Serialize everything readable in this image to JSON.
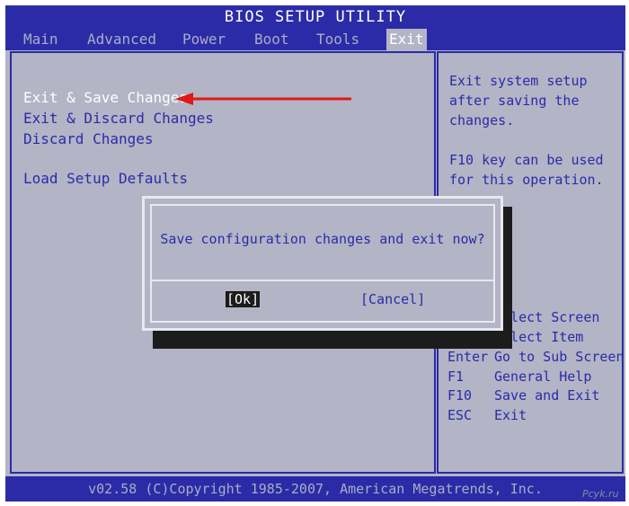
{
  "title": "BIOS SETUP UTILITY",
  "menu": [
    {
      "label": "Main",
      "active": false
    },
    {
      "label": "Advanced",
      "active": false
    },
    {
      "label": "Power",
      "active": false
    },
    {
      "label": "Boot",
      "active": false
    },
    {
      "label": "Tools",
      "active": false
    },
    {
      "label": "Exit",
      "active": true
    }
  ],
  "options": [
    {
      "label": "Exit & Save Changes",
      "selected": true
    },
    {
      "label": "Exit & Discard Changes",
      "selected": false
    },
    {
      "label": "Discard Changes",
      "selected": false
    },
    {
      "label": "Load Setup Defaults",
      "selected": false
    }
  ],
  "help": {
    "lines": [
      "Exit system setup",
      "after saving the",
      "changes.",
      "",
      "F10 key can be used",
      "for this operation."
    ],
    "keys": [
      {
        "key": "←→",
        "desc": "Select Screen"
      },
      {
        "key": "↑↓",
        "desc": "Select Item"
      },
      {
        "key": "Enter",
        "desc": "Go to Sub Screen"
      },
      {
        "key": "F1",
        "desc": "General Help"
      },
      {
        "key": "F10",
        "desc": "Save and Exit"
      },
      {
        "key": "ESC",
        "desc": "Exit"
      }
    ]
  },
  "dialog": {
    "message": "Save configuration changes and exit now?",
    "ok_label": "[Ok]",
    "cancel_label": "[Cancel]"
  },
  "status": "v02.58 (C)Copyright 1985-2007, American Megatrends, Inc.",
  "watermark": "Pcyk.ru",
  "colors": {
    "bios_blue": "#2b2ba8",
    "bios_gray": "#b3b4c5",
    "arrow_red": "#e01818"
  }
}
